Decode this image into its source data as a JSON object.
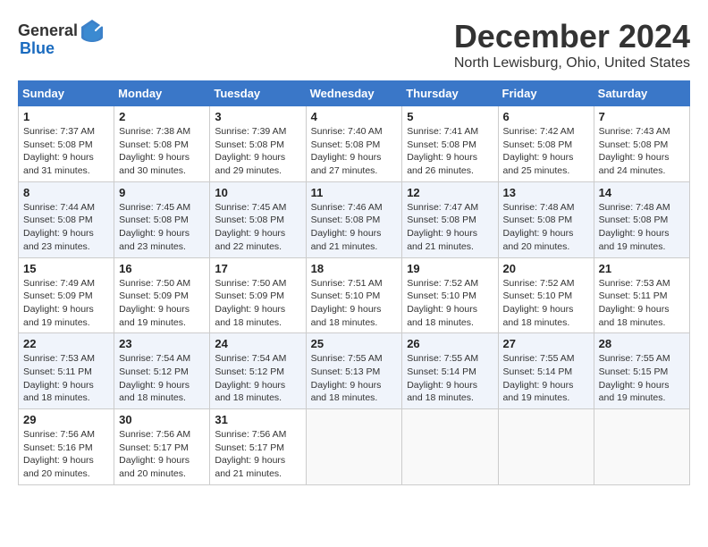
{
  "header": {
    "logo_general": "General",
    "logo_blue": "Blue",
    "title": "December 2024",
    "location": "North Lewisburg, Ohio, United States"
  },
  "weekdays": [
    "Sunday",
    "Monday",
    "Tuesday",
    "Wednesday",
    "Thursday",
    "Friday",
    "Saturday"
  ],
  "weeks": [
    [
      {
        "day": "1",
        "sunrise": "7:37 AM",
        "sunset": "5:08 PM",
        "daylight": "9 hours and 31 minutes."
      },
      {
        "day": "2",
        "sunrise": "7:38 AM",
        "sunset": "5:08 PM",
        "daylight": "9 hours and 30 minutes."
      },
      {
        "day": "3",
        "sunrise": "7:39 AM",
        "sunset": "5:08 PM",
        "daylight": "9 hours and 29 minutes."
      },
      {
        "day": "4",
        "sunrise": "7:40 AM",
        "sunset": "5:08 PM",
        "daylight": "9 hours and 27 minutes."
      },
      {
        "day": "5",
        "sunrise": "7:41 AM",
        "sunset": "5:08 PM",
        "daylight": "9 hours and 26 minutes."
      },
      {
        "day": "6",
        "sunrise": "7:42 AM",
        "sunset": "5:08 PM",
        "daylight": "9 hours and 25 minutes."
      },
      {
        "day": "7",
        "sunrise": "7:43 AM",
        "sunset": "5:08 PM",
        "daylight": "9 hours and 24 minutes."
      }
    ],
    [
      {
        "day": "8",
        "sunrise": "7:44 AM",
        "sunset": "5:08 PM",
        "daylight": "9 hours and 23 minutes."
      },
      {
        "day": "9",
        "sunrise": "7:45 AM",
        "sunset": "5:08 PM",
        "daylight": "9 hours and 23 minutes."
      },
      {
        "day": "10",
        "sunrise": "7:45 AM",
        "sunset": "5:08 PM",
        "daylight": "9 hours and 22 minutes."
      },
      {
        "day": "11",
        "sunrise": "7:46 AM",
        "sunset": "5:08 PM",
        "daylight": "9 hours and 21 minutes."
      },
      {
        "day": "12",
        "sunrise": "7:47 AM",
        "sunset": "5:08 PM",
        "daylight": "9 hours and 21 minutes."
      },
      {
        "day": "13",
        "sunrise": "7:48 AM",
        "sunset": "5:08 PM",
        "daylight": "9 hours and 20 minutes."
      },
      {
        "day": "14",
        "sunrise": "7:48 AM",
        "sunset": "5:08 PM",
        "daylight": "9 hours and 19 minutes."
      }
    ],
    [
      {
        "day": "15",
        "sunrise": "7:49 AM",
        "sunset": "5:09 PM",
        "daylight": "9 hours and 19 minutes."
      },
      {
        "day": "16",
        "sunrise": "7:50 AM",
        "sunset": "5:09 PM",
        "daylight": "9 hours and 19 minutes."
      },
      {
        "day": "17",
        "sunrise": "7:50 AM",
        "sunset": "5:09 PM",
        "daylight": "9 hours and 18 minutes."
      },
      {
        "day": "18",
        "sunrise": "7:51 AM",
        "sunset": "5:10 PM",
        "daylight": "9 hours and 18 minutes."
      },
      {
        "day": "19",
        "sunrise": "7:52 AM",
        "sunset": "5:10 PM",
        "daylight": "9 hours and 18 minutes."
      },
      {
        "day": "20",
        "sunrise": "7:52 AM",
        "sunset": "5:10 PM",
        "daylight": "9 hours and 18 minutes."
      },
      {
        "day": "21",
        "sunrise": "7:53 AM",
        "sunset": "5:11 PM",
        "daylight": "9 hours and 18 minutes."
      }
    ],
    [
      {
        "day": "22",
        "sunrise": "7:53 AM",
        "sunset": "5:11 PM",
        "daylight": "9 hours and 18 minutes."
      },
      {
        "day": "23",
        "sunrise": "7:54 AM",
        "sunset": "5:12 PM",
        "daylight": "9 hours and 18 minutes."
      },
      {
        "day": "24",
        "sunrise": "7:54 AM",
        "sunset": "5:12 PM",
        "daylight": "9 hours and 18 minutes."
      },
      {
        "day": "25",
        "sunrise": "7:55 AM",
        "sunset": "5:13 PM",
        "daylight": "9 hours and 18 minutes."
      },
      {
        "day": "26",
        "sunrise": "7:55 AM",
        "sunset": "5:14 PM",
        "daylight": "9 hours and 18 minutes."
      },
      {
        "day": "27",
        "sunrise": "7:55 AM",
        "sunset": "5:14 PM",
        "daylight": "9 hours and 19 minutes."
      },
      {
        "day": "28",
        "sunrise": "7:55 AM",
        "sunset": "5:15 PM",
        "daylight": "9 hours and 19 minutes."
      }
    ],
    [
      {
        "day": "29",
        "sunrise": "7:56 AM",
        "sunset": "5:16 PM",
        "daylight": "9 hours and 20 minutes."
      },
      {
        "day": "30",
        "sunrise": "7:56 AM",
        "sunset": "5:17 PM",
        "daylight": "9 hours and 20 minutes."
      },
      {
        "day": "31",
        "sunrise": "7:56 AM",
        "sunset": "5:17 PM",
        "daylight": "9 hours and 21 minutes."
      },
      null,
      null,
      null,
      null
    ]
  ],
  "labels": {
    "sunrise": "Sunrise:",
    "sunset": "Sunset:",
    "daylight": "Daylight:"
  }
}
